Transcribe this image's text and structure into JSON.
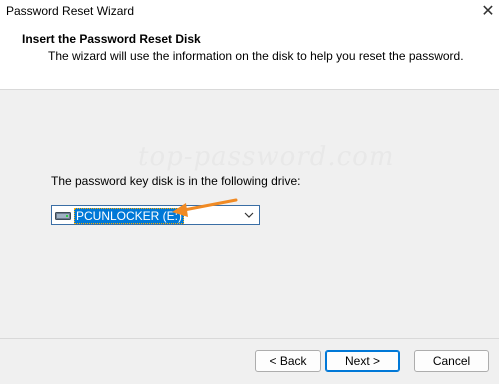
{
  "window": {
    "title": "Password Reset Wizard",
    "close_glyph": "✕"
  },
  "header": {
    "title": "Insert the Password Reset Disk",
    "subtitle": "The wizard will use the information on the disk to help you reset the password."
  },
  "body": {
    "watermark": "top-password.com",
    "drive_label": "The password key disk is in the following drive:",
    "drive_select": {
      "selected": "PCUNLOCKER (E:)",
      "icon": "usb-drive-icon"
    }
  },
  "buttons": {
    "back": "< Back",
    "next": "Next >",
    "cancel": "Cancel"
  },
  "colors": {
    "selection": "#0078d7",
    "annotation_arrow": "#f08a24"
  }
}
